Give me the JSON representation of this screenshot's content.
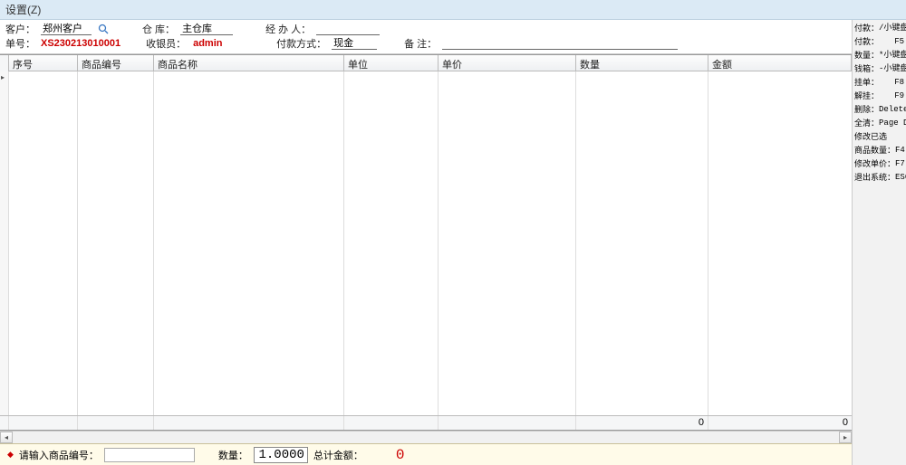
{
  "menu": {
    "settings": "设置(Z)"
  },
  "header": {
    "customer_label": "客户：",
    "customer_value": "郑州客户",
    "warehouse_label": "仓  库：",
    "warehouse_value": "主仓库",
    "handler_label": "经 办 人：",
    "handler_value": "",
    "orderno_label": "单号：",
    "orderno_value": "XS230213010001",
    "cashier_label": "收银员：",
    "cashier_value": "admin",
    "paytype_label": "付款方式：",
    "paytype_value": "现金",
    "remark_label": "备  注：",
    "remark_value": ""
  },
  "columns": {
    "c1": "序号",
    "c2": "商品编号",
    "c3": "商品名称",
    "c4": "单位",
    "c5": "单价",
    "c6": "数量",
    "c7": "金额"
  },
  "footer_totals": {
    "qty": "0",
    "amount": "0"
  },
  "bottombar": {
    "prompt": "请输入商品编号：",
    "code_value": "",
    "qty_label": "数量：",
    "qty_value": "1.0000",
    "total_label": "总计金额：",
    "total_value": "0"
  },
  "shortcuts": [
    {
      "k": "付款：",
      "v": "/小键盘"
    },
    {
      "k": "付款：",
      "v": "F5"
    },
    {
      "k": "数量：",
      "v": "*小键盘"
    },
    {
      "k": "钱箱：",
      "v": "-小键盘"
    },
    {
      "k": "挂单：",
      "v": "F8"
    },
    {
      "k": "解挂：",
      "v": "F9"
    },
    {
      "k": "删除：",
      "v": "Delete"
    },
    {
      "k": "全清：",
      "v": "Page Down"
    },
    {
      "k": "修改已选",
      "v": ""
    },
    {
      "k": "商品数量：",
      "v": "F4"
    },
    {
      "k": "修改单价：",
      "v": "F7"
    },
    {
      "k": "退出系统：",
      "v": "ESC"
    }
  ]
}
